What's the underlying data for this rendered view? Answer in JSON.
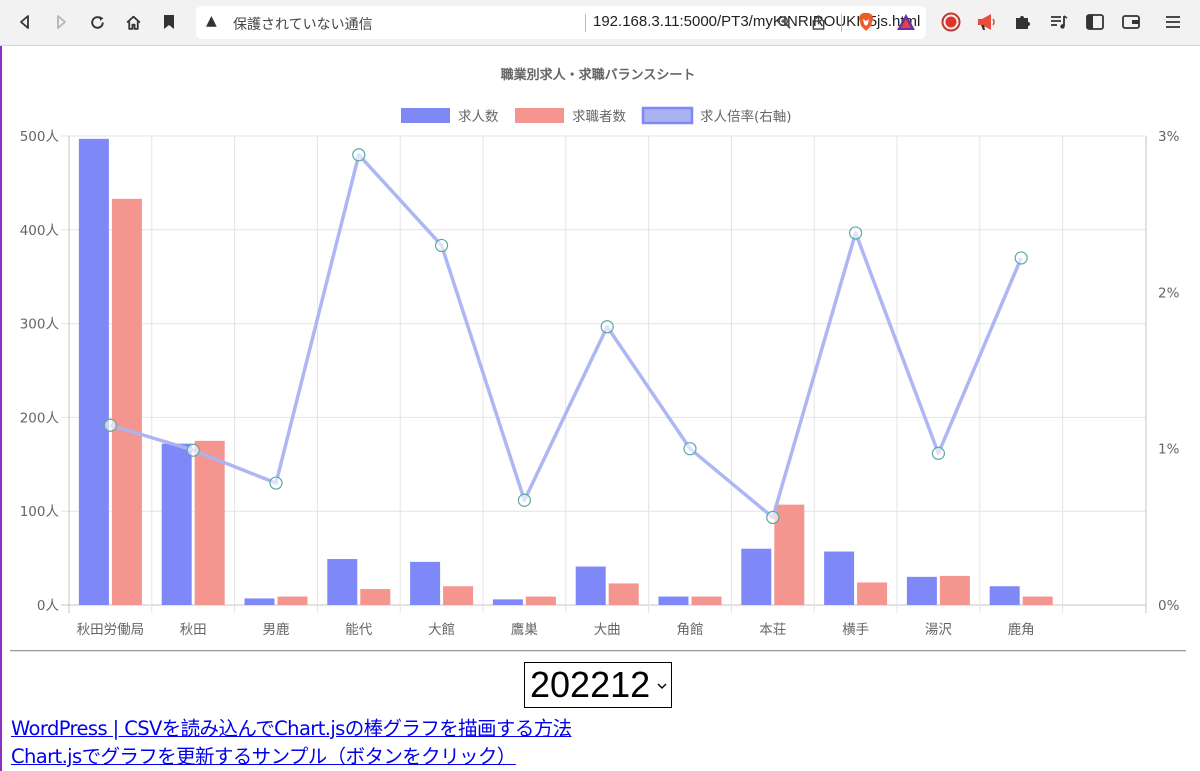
{
  "browser": {
    "insecure_label": "保護されていない通信",
    "url": "192.168.3.11:5000/PT3/myKINRIROUKI05js.html"
  },
  "chart_data": {
    "type": "bar",
    "title": "職業別求人・求職バランスシート",
    "categories": [
      "秋田労働局",
      "秋田",
      "男鹿",
      "能代",
      "大館",
      "鷹巣",
      "大曲",
      "角館",
      "本荘",
      "横手",
      "湯沢",
      "鹿角"
    ],
    "series": [
      {
        "name": "求人数",
        "type": "bar",
        "axis": "left",
        "color": "#7f88f7",
        "values": [
          497,
          172,
          7,
          49,
          46,
          6,
          41,
          9,
          60,
          57,
          30,
          20
        ]
      },
      {
        "name": "求職者数",
        "type": "bar",
        "axis": "left",
        "color": "#f4958f",
        "values": [
          433,
          175,
          9,
          17,
          20,
          9,
          23,
          9,
          107,
          24,
          31,
          9
        ]
      },
      {
        "name": "求人倍率(右軸)",
        "type": "line",
        "axis": "right",
        "color": "#aab3f2",
        "values": [
          1.15,
          0.99,
          0.78,
          2.88,
          2.3,
          0.67,
          1.78,
          1.0,
          0.56,
          2.38,
          0.97,
          2.22
        ]
      }
    ],
    "y_left": {
      "min": 0,
      "max": 500,
      "step": 100,
      "ticks": [
        "0人",
        "100人",
        "200人",
        "300人",
        "400人",
        "500人"
      ]
    },
    "y_right": {
      "min": 0,
      "max": 3,
      "step": 1,
      "ticks": [
        "0%",
        "1%",
        "2%",
        "3%"
      ]
    },
    "legend_position": "top",
    "grid": true
  },
  "controls": {
    "month_select_value": "202212"
  },
  "links": [
    "WordPress | CSVを読み込んでChart.jsの棒グラフを描画する方法",
    "Chart.jsでグラフを更新するサンプル（ボタンをクリック）"
  ]
}
